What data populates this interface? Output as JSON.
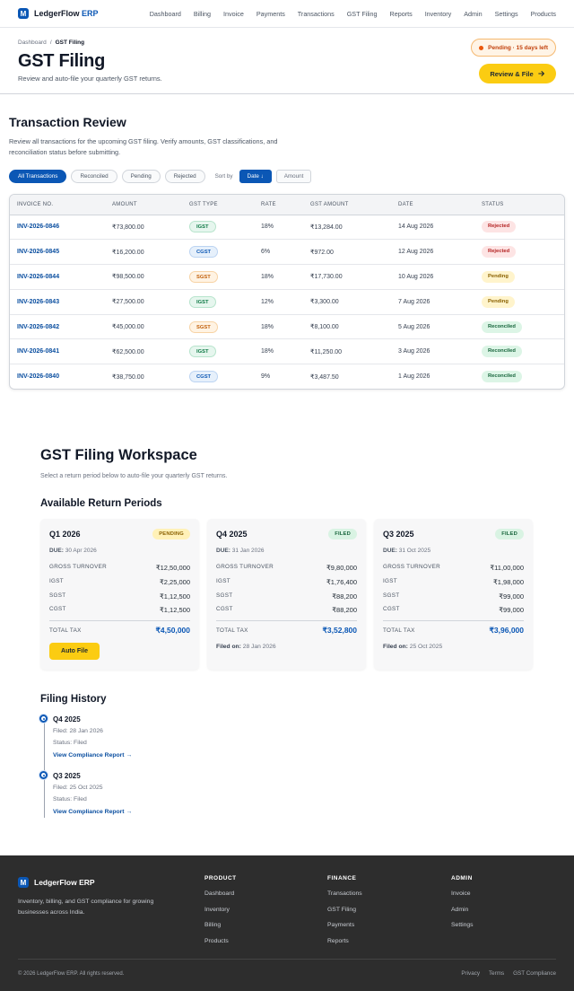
{
  "brand": {
    "name": "LedgerFlow",
    "suffix": "ERP",
    "mark": "M"
  },
  "nav": [
    "Dashboard",
    "Billing",
    "Invoice",
    "Payments",
    "Transactions",
    "GST Filing",
    "Reports",
    "Inventory",
    "Admin",
    "Settings",
    "Products"
  ],
  "header": {
    "breadcrumb": [
      "Dashboard",
      "/",
      "GST Filing"
    ],
    "title": "GST Filing",
    "subtitle": "Review and auto-file your quarterly GST returns.",
    "status_chip": "Pending · 15 days left",
    "primary_button": "Review & File",
    "primary_button_icon": "arrow-right-icon"
  },
  "review": {
    "title": "Transaction Review",
    "description": "Review all transactions for the upcoming GST filing. Verify amounts, GST classifications, and reconciliation status before submitting.",
    "filters": [
      "All Transactions",
      "Reconciled",
      "Pending",
      "Rejected"
    ],
    "active_filter": "All Transactions",
    "sort_label": "Sort by",
    "sort_options": [
      "Date ↓",
      "Amount"
    ],
    "active_sort": "Date ↓",
    "columns": [
      "INVOICE NO.",
      "AMOUNT",
      "GST TYPE",
      "RATE",
      "GST AMOUNT",
      "DATE",
      "STATUS"
    ],
    "rows": [
      {
        "invoice": "INV-2026-0846",
        "amount": "₹73,800.00",
        "gst_type": "IGST",
        "rate": "18%",
        "gst_amount": "₹13,284.00",
        "date": "14 Aug 2026",
        "status": "Rejected"
      },
      {
        "invoice": "INV-2026-0845",
        "amount": "₹16,200.00",
        "gst_type": "CGST",
        "rate": "6%",
        "gst_amount": "₹972.00",
        "date": "12 Aug 2026",
        "status": "Rejected"
      },
      {
        "invoice": "INV-2026-0844",
        "amount": "₹98,500.00",
        "gst_type": "SGST",
        "rate": "18%",
        "gst_amount": "₹17,730.00",
        "date": "10 Aug 2026",
        "status": "Pending"
      },
      {
        "invoice": "INV-2026-0843",
        "amount": "₹27,500.00",
        "gst_type": "IGST",
        "rate": "12%",
        "gst_amount": "₹3,300.00",
        "date": "7 Aug 2026",
        "status": "Pending"
      },
      {
        "invoice": "INV-2026-0842",
        "amount": "₹45,000.00",
        "gst_type": "SGST",
        "rate": "18%",
        "gst_amount": "₹8,100.00",
        "date": "5 Aug 2026",
        "status": "Reconciled"
      },
      {
        "invoice": "INV-2026-0841",
        "amount": "₹62,500.00",
        "gst_type": "IGST",
        "rate": "18%",
        "gst_amount": "₹11,250.00",
        "date": "3 Aug 2026",
        "status": "Reconciled"
      },
      {
        "invoice": "INV-2026-0840",
        "amount": "₹38,750.00",
        "gst_type": "CGST",
        "rate": "9%",
        "gst_amount": "₹3,487.50",
        "date": "1 Aug 2026",
        "status": "Reconciled"
      }
    ]
  },
  "workspace": {
    "title": "GST Filing Workspace",
    "subtitle": "Select a return period below to auto-file your quarterly GST returns.",
    "periods_title": "Available Return Periods",
    "periods": [
      {
        "quarter": "Q1 2026",
        "badge": "PENDING",
        "due_label": "DUE:",
        "due": "30 Apr 2026",
        "rows": [
          [
            "GROSS TURNOVER",
            "₹12,50,000"
          ],
          [
            "IGST",
            "₹2,25,000"
          ],
          [
            "SGST",
            "₹1,12,500"
          ],
          [
            "CGST",
            "₹1,12,500"
          ]
        ],
        "total_label": "TOTAL TAX",
        "total": "₹4,50,000",
        "action": "Auto File",
        "filed_label": "",
        "filed_on": ""
      },
      {
        "quarter": "Q4 2025",
        "badge": "FILED",
        "due_label": "DUE:",
        "due": "31 Jan 2026",
        "rows": [
          [
            "GROSS TURNOVER",
            "₹9,80,000"
          ],
          [
            "IGST",
            "₹1,76,400"
          ],
          [
            "SGST",
            "₹88,200"
          ],
          [
            "CGST",
            "₹88,200"
          ]
        ],
        "total_label": "TOTAL TAX",
        "total": "₹3,52,800",
        "action": "",
        "filed_label": "Filed on:",
        "filed_on": "28 Jan 2026"
      },
      {
        "quarter": "Q3 2025",
        "badge": "FILED",
        "due_label": "DUE:",
        "due": "31 Oct 2025",
        "rows": [
          [
            "GROSS TURNOVER",
            "₹11,00,000"
          ],
          [
            "IGST",
            "₹1,98,000"
          ],
          [
            "SGST",
            "₹99,000"
          ],
          [
            "CGST",
            "₹99,000"
          ]
        ],
        "total_label": "TOTAL TAX",
        "total": "₹3,96,000",
        "action": "",
        "filed_label": "Filed on:",
        "filed_on": "25 Oct 2025"
      }
    ]
  },
  "history": {
    "title": "Filing History",
    "items": [
      {
        "quarter": "Q4 2025",
        "filed": "Filed: 28 Jan 2026",
        "status": "Status: Filed",
        "link": "View Compliance Report →"
      },
      {
        "quarter": "Q3 2025",
        "filed": "Filed: 25 Oct 2025",
        "status": "Status: Filed",
        "link": "View Compliance Report →"
      }
    ]
  },
  "footer": {
    "description": "Inventory, billing, and GST compliance for growing businesses across India.",
    "columns": [
      {
        "title": "PRODUCT",
        "items": [
          "Dashboard",
          "Inventory",
          "Billing",
          "Products"
        ]
      },
      {
        "title": "FINANCE",
        "items": [
          "Transactions",
          "GST Filing",
          "Payments",
          "Reports"
        ]
      },
      {
        "title": "ADMIN",
        "items": [
          "Invoice",
          "Admin",
          "Settings"
        ]
      }
    ],
    "copyright": "© 2026 LedgerFlow ERP. All rights reserved.",
    "legal": [
      "Privacy",
      "Terms",
      "GST Compliance"
    ]
  },
  "colors": {
    "brand": "#0b57b5",
    "accent_yellow": "#fbcc12",
    "footer_bg": "#2d2d2d"
  }
}
